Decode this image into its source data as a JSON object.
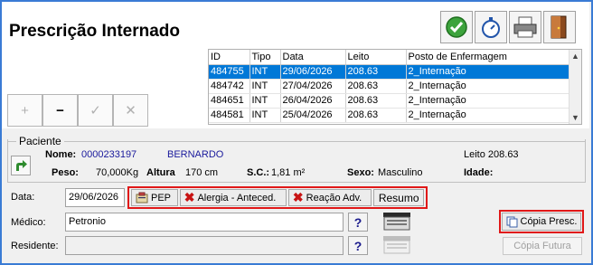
{
  "header": {
    "title": "Prescrição Internado",
    "toolbar_icons": [
      "confirm-icon",
      "stopwatch-icon",
      "printer-icon",
      "exit-door-icon"
    ]
  },
  "nav": {
    "icons": [
      "plus-icon",
      "minus-icon",
      "check-icon",
      "cross-icon"
    ],
    "symbols": [
      "+",
      "−",
      "✓",
      "✕"
    ]
  },
  "grid": {
    "columns": [
      "ID",
      "Tipo",
      "Data",
      "Leito",
      "Posto de Enfermagem"
    ],
    "rows": [
      [
        "484755",
        "INT",
        "29/06/2026",
        "208.63",
        "2_Internação"
      ],
      [
        "484742",
        "INT",
        "27/04/2026",
        "208.63",
        "2_Internação"
      ],
      [
        "484651",
        "INT",
        "26/04/2026",
        "208.63",
        "2_Internação"
      ],
      [
        "484581",
        "INT",
        "25/04/2026",
        "208.63",
        "2_Internação"
      ]
    ],
    "selected_row": 0
  },
  "patient": {
    "legend": "Paciente",
    "nome_label": "Nome:",
    "nome_code": "0000233197",
    "nome_value": "BERNARDO",
    "leito": "Leito 208.63",
    "peso_label": "Peso:",
    "peso_value": "70,000Kg",
    "altura_label": "Altura",
    "altura_value": "170  cm",
    "sc_label": "S.C.:",
    "sc_value": "1,81 m²",
    "sexo_label": "Sexo:",
    "sexo_value": "Masculino",
    "idade_label": "Idade:"
  },
  "form": {
    "data_label": "Data:",
    "data_value": "29/06/2026",
    "medico_label": "Médico:",
    "medico_value": "Petronio",
    "residente_label": "Residente:",
    "residente_value": "",
    "help": "?"
  },
  "actions": {
    "pep": "PEP",
    "alergia": "Alergia - Anteced.",
    "reacao": "Reação Adv.",
    "resumo": "Resumo"
  },
  "copy": {
    "copia_presc": "Cópia Presc.",
    "copia_futura": "Cópia Futura"
  },
  "colors": {
    "frame": "#3a7bd5",
    "highlight": "#e01818",
    "selection": "#0078d7",
    "patient_code": "#1a1a9c"
  }
}
